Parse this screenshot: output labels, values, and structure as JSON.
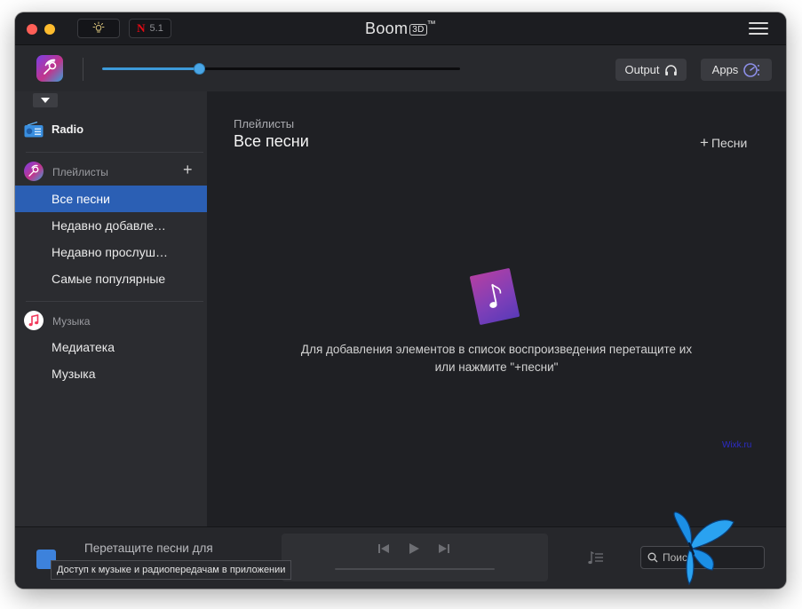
{
  "window": {
    "title_main": "Boom",
    "title_badge": "3D",
    "title_tm": "™",
    "netflix_badge": "N",
    "audio_format": "5.1"
  },
  "toolbar": {
    "volume_percent": 27,
    "output_label": "Output",
    "apps_label": "Apps"
  },
  "sidebar": {
    "radio_label": "Radio",
    "playlists_header": "Плейлисты",
    "add_playlist": "+",
    "playlists": [
      {
        "label": "Все песни",
        "active": true
      },
      {
        "label": "Недавно добавленные"
      },
      {
        "label": "Недавно прослушанные"
      },
      {
        "label": "Самые популярные"
      }
    ],
    "music_header": "Музыка",
    "music_items": [
      {
        "label": "Медиатека"
      },
      {
        "label": "Музыка"
      }
    ]
  },
  "main": {
    "breadcrumb": "Плейлисты",
    "title": "Все песни",
    "add_plus": "+",
    "add_songs_label": "Песни",
    "empty_line1": "Для добавления элементов в список воспроизведения перетащите их",
    "empty_line2": "или нажмите \"+песни\"",
    "watermark": "Wixk.ru"
  },
  "bottom": {
    "track_text": "Перетащите песни для",
    "tooltip": "Доступ к музыке и радиопередачам в приложении",
    "search_placeholder": "Поиск"
  },
  "colors": {
    "accent": "#2b5fb4",
    "volume": "#3d9ad9",
    "window_bg": "#1f2024",
    "sidebar_bg": "#2b2c30"
  }
}
